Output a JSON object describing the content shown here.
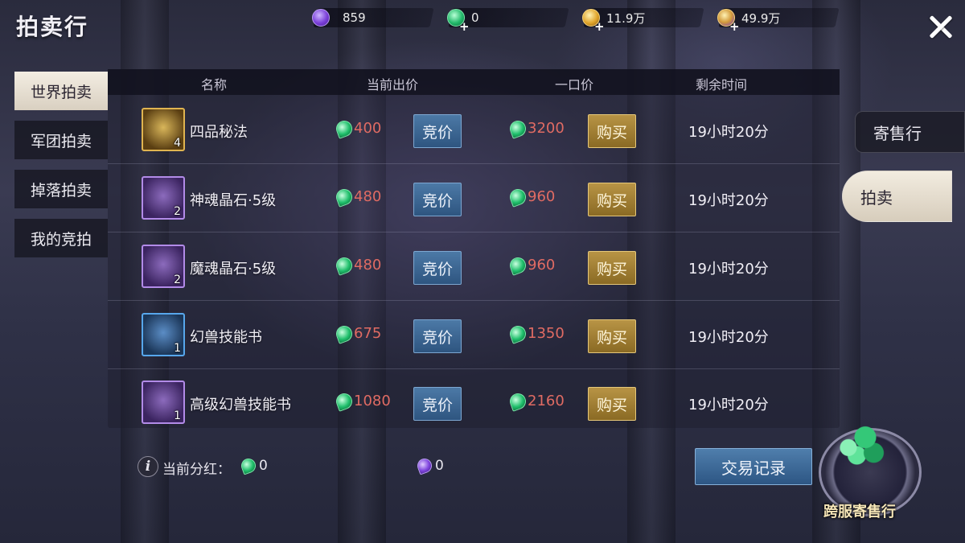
{
  "header": {
    "title": "拍卖行",
    "currencies": [
      {
        "icon": "purple-gem-icon",
        "plus": false,
        "value": "859"
      },
      {
        "icon": "green-gem-icon",
        "plus": true,
        "value": "0"
      },
      {
        "icon": "gold-coin-icon",
        "plus": true,
        "value": "11.9万"
      },
      {
        "icon": "purple-gold-coin-icon",
        "plus": true,
        "value": "49.9万"
      }
    ],
    "plus_symbol": "+"
  },
  "left_tabs": [
    "世界拍卖",
    "军团拍卖",
    "掉落拍卖",
    "我的竞拍"
  ],
  "active_left_tab": 0,
  "table": {
    "columns": [
      "名称",
      "当前出价",
      "一口价",
      "剩余时间"
    ],
    "bid_label": "竞价",
    "buy_label": "购买",
    "rows": [
      {
        "name": "四品秘法",
        "qty": "4",
        "frame": "gold",
        "icon": "treasure-chest-icon",
        "bid": "400",
        "buyout": "3200",
        "time": "19小时20分"
      },
      {
        "name": "神魂晶石·5级",
        "qty": "2",
        "frame": "purple",
        "icon": "dark-orb-icon",
        "bid": "480",
        "buyout": "960",
        "time": "19小时20分"
      },
      {
        "name": "魔魂晶石·5级",
        "qty": "2",
        "frame": "purple",
        "icon": "amber-gem-icon",
        "bid": "480",
        "buyout": "960",
        "time": "19小时20分"
      },
      {
        "name": "幻兽技能书",
        "qty": "1",
        "frame": "blue",
        "icon": "skill-book-chest-icon",
        "bid": "675",
        "buyout": "1350",
        "time": "19小时20分"
      },
      {
        "name": "高级幻兽技能书",
        "qty": "1",
        "frame": "purple",
        "icon": "advanced-skill-book-chest-icon",
        "bid": "1080",
        "buyout": "2160",
        "time": "19小时20分"
      }
    ]
  },
  "bottom": {
    "info_symbol": "i",
    "bonus_label": "当前分红：",
    "bonus_green": "0",
    "bonus_purple": "0",
    "history_button": "交易记录"
  },
  "right_tabs": [
    "寄售行",
    "拍卖"
  ],
  "active_right_tab": 1,
  "cross_server_label": "跨服寄售行",
  "colors": {
    "price_red": "#e06b63",
    "bid_blue": "#2e5580",
    "buy_gold": "#8a6a24"
  }
}
